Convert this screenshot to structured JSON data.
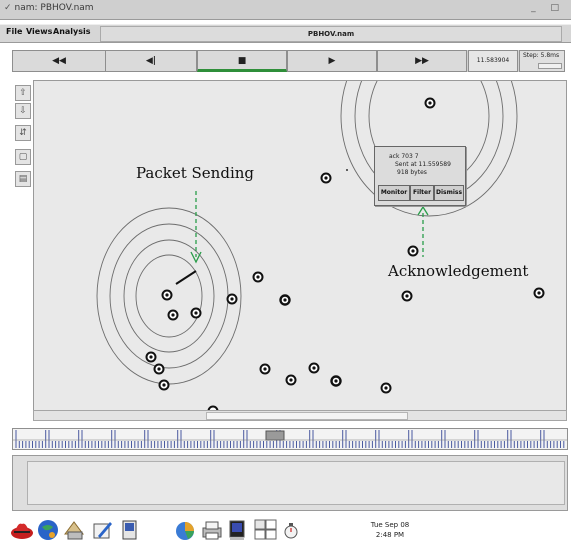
{
  "window": {
    "title": "nam: PBHOV.nam",
    "controls": "_ □"
  },
  "menu": {
    "items": [
      "File",
      "Views",
      "Analysis"
    ],
    "center_title": "PBHOV.nam"
  },
  "playback": {
    "buttons": [
      {
        "name": "rewind-button",
        "glyph": "◀◀"
      },
      {
        "name": "step-back-button",
        "glyph": "◀|"
      },
      {
        "name": "stop-button",
        "glyph": "■"
      },
      {
        "name": "play-button",
        "glyph": "▶"
      },
      {
        "name": "fast-forward-button",
        "glyph": "▶▶"
      }
    ],
    "time": "11.583904",
    "step_label": "Step: 5.8ms"
  },
  "tools": [
    "zoom-in-icon",
    "zoom-out-icon",
    "split-icon",
    "record-icon",
    "layout-icon"
  ],
  "popup": {
    "line1": "ack 703 7",
    "line2": "Sent at 11.559589",
    "line3": "918 bytes",
    "monitor": "Monitor",
    "filter": "Filter",
    "dismiss": "Dismiss"
  },
  "annotations": {
    "packet_sending": "Packet Sending",
    "acknowledgement": "Acknowledgement"
  },
  "clock": {
    "date": "Tue Sep 08",
    "time": "2:48 PM"
  },
  "colors": {
    "accent_green": "#2f8f3a",
    "annotation_arrow": "#2a9d4a",
    "panel": "#d6d6d6",
    "canvas": "#e9e9e9"
  }
}
